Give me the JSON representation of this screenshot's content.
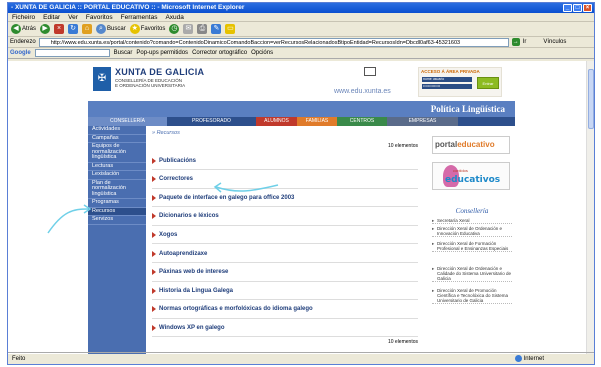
{
  "window": {
    "title": "- XUNTA DE GALICIA :: PORTAL EDUCATIVO :: - Microsoft Internet Explorer"
  },
  "menu": [
    "Ficheiro",
    "Editar",
    "Ver",
    "Favoritos",
    "Ferramentas",
    "Axuda"
  ],
  "toolbar": {
    "back": "Atrás",
    "search": "Buscar",
    "favorites": "Favoritos"
  },
  "address": {
    "label": "Enderezo",
    "url": "http://www.edu.xunta.es/portal/contenido?comando=ContenidoDinamicoComandoBaccion=verRecursosRelacionadosBtipoEntidad=RecursosIdn=Dbcdl0af63-45321603",
    "go": "Ir",
    "links": "Vínculos"
  },
  "google": {
    "label": "Google",
    "search": "Buscar",
    "popups": "Pop-ups permitidos",
    "spell": "Corrector ortográfico",
    "options": "Opcións"
  },
  "header": {
    "org": "XUNTA DE GALICIA",
    "dept1": "CONSELLERÍA DE EDUCACIÓN",
    "dept2": "E ORDENACIÓN UNIVERSITARIA",
    "web": "www.edu.xunta.es",
    "private_title": "ACCESO Á ÁREA PRIVADA",
    "user_field": "nome usuario",
    "pass_field": "••••••••••••••",
    "enter": "Entrar"
  },
  "section": "Política Lingüística",
  "tabs": [
    {
      "label": "CONSELLERÍA",
      "color": "#6d8cc6"
    },
    {
      "label": "PROFESORADO",
      "color": "#2d4f8c"
    },
    {
      "label": "ALUMNOS",
      "color": "#c0392b"
    },
    {
      "label": "FAMILIAS",
      "color": "#e07b2a"
    },
    {
      "label": "CENTROS",
      "color": "#3a8a4a"
    },
    {
      "label": "EMPRESAS",
      "color": "#5a6b8a"
    }
  ],
  "nav": [
    "Actividades",
    "Campañas",
    "Equipos de normalización lingüística",
    "Lecturas",
    "Lexislación",
    "Plan de normalización lingüística",
    "Programas",
    "Recursos",
    "Servizos"
  ],
  "breadcrumb": "» Recursos",
  "count": "10 elementos",
  "items": [
    "Publicacións",
    "Correctores",
    "Paquete de interface en galego para office 2003",
    "Dicionarios e léxicos",
    "Xogos",
    "Autoaprendizaxe",
    "Páxinas web de interese",
    "Historia da Lingua Galega",
    "Normas ortográficas e morfolóxicas do idioma galego",
    "Windows XP en galego"
  ],
  "right": {
    "portal": "portal",
    "educativo": "educativo",
    "contidos": "contidos",
    "educativos": "educativos",
    "consellaria": "Consellería",
    "links": [
      "Secretaría Xeral",
      "Dirección Xeral de Ordenación e Innovación Educativa",
      "Dirección Xeral de Formación Profesional e Ensinanzas Especiais",
      "Dirección Xeral de Ordenación e Calidade do Sistema Universitario de Galicia",
      "Dirección Xeral de Promoción Científica e Tecnolóxica do Sistema Universitario de Galicia"
    ]
  },
  "status": {
    "left": "Feito",
    "zone": "Internet"
  }
}
